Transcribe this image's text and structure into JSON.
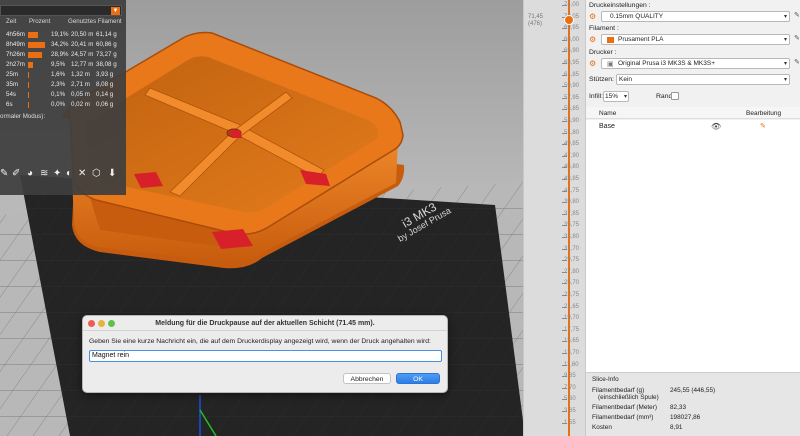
{
  "stats": {
    "headers": {
      "time": "Zeit",
      "percent": "Prozent",
      "used": "Genutztes Filament"
    },
    "rows": [
      {
        "time": "4h56m",
        "percent": "19,1%",
        "meters": "20,50 m",
        "grams": "61,14 g",
        "fraction": 0.191
      },
      {
        "time": "8h49m",
        "percent": "34,2%",
        "meters": "20,41 m",
        "grams": "60,86 g",
        "fraction": 0.342
      },
      {
        "time": "7h26m",
        "percent": "28,9%",
        "meters": "24,57 m",
        "grams": "73,27 g",
        "fraction": 0.289
      },
      {
        "time": "2h27m",
        "percent": "9,5%",
        "meters": "12,77 m",
        "grams": "38,08 g",
        "fraction": 0.095
      },
      {
        "time": "25m",
        "percent": "1,6%",
        "meters": "1,32 m",
        "grams": "3,93 g",
        "fraction": 0.016
      },
      {
        "time": "35m",
        "percent": "2,3%",
        "meters": "2,71 m",
        "grams": "8,08 g",
        "fraction": 0.023
      },
      {
        "time": "54s",
        "percent": "0,1%",
        "meters": "0,05 m",
        "grams": "0,14 g",
        "fraction": 0.001
      },
      {
        "time": "6s",
        "percent": "0,0%",
        "meters": "0,02 m",
        "grams": "0,06 g",
        "fraction": 0.0
      }
    ],
    "mode_note": "ormaler Modus):",
    "dropdown_arrow": "▼"
  },
  "bed": {
    "label_line1": "i3 MK3",
    "label_line2": "by Josef Prusa"
  },
  "dialog": {
    "title": "Meldung für die Druckpause auf der aktuellen Schicht (71.45 mm).",
    "message": "Geben Sie eine kurze Nachricht ein, die auf dem Druckerdisplay angezeigt wird, wenn der Druck angehalten wird:",
    "input_value": "Magnet rein",
    "cancel_label": "Abbrechen",
    "ok_label": "OK"
  },
  "ruler": {
    "current_height": "71,45",
    "current_layer": "(476)",
    "labels": [
      "74,00",
      "72,05",
      "69,95",
      "68,00",
      "65,90",
      "63,95",
      "61,85",
      "59,90",
      "57,95",
      "55,85",
      "53,90",
      "51,80",
      "49,85",
      "47,90",
      "45,80",
      "43,85",
      "41,75",
      "39,80",
      "37,85",
      "35,75",
      "33,80",
      "31,70",
      "29,75",
      "27,80",
      "25,70",
      "23,75",
      "21,65",
      "19,70",
      "17,75",
      "15,65",
      "13,70",
      "11,60",
      "9,65",
      "7,70",
      "5,60",
      "3,65",
      "1,55"
    ]
  },
  "panel": {
    "print_settings_label": "Druckeinstellungen :",
    "print_settings_value": "0.15mm QUALITY",
    "filament_label": "Filament :",
    "filament_value": "Prusament PLA",
    "printer_label": "Drucker :",
    "printer_value": "Original Prusa i3 MK3S & MK3S+",
    "supports_label": "Stützen:",
    "supports_value": "Kein",
    "infill_label": "Infill:",
    "infill_value": "15%",
    "brim_label": "Rand:",
    "col_name": "Name",
    "col_edit": "Bearbeitung",
    "object_name": "Base",
    "slice_info": {
      "title": "Slice-Info",
      "filament_g_label": "Filamentbedarf (g)",
      "filament_g_sub": "(einschließlich Spule)",
      "filament_g_value": "245,55 (446,55)",
      "filament_m_label": "Filamentbedarf (Meter)",
      "filament_m_value": "82,33",
      "filament_mm3_label": "Filamentbedarf (mm³)",
      "filament_mm3_value": "198027,86",
      "cost_label": "Kosten",
      "cost_value": "8,91"
    }
  },
  "colors": {
    "accent": "#e96f12",
    "model": "#e2741a",
    "magnet_pocket": "#d8202a",
    "bed": "#242424"
  }
}
